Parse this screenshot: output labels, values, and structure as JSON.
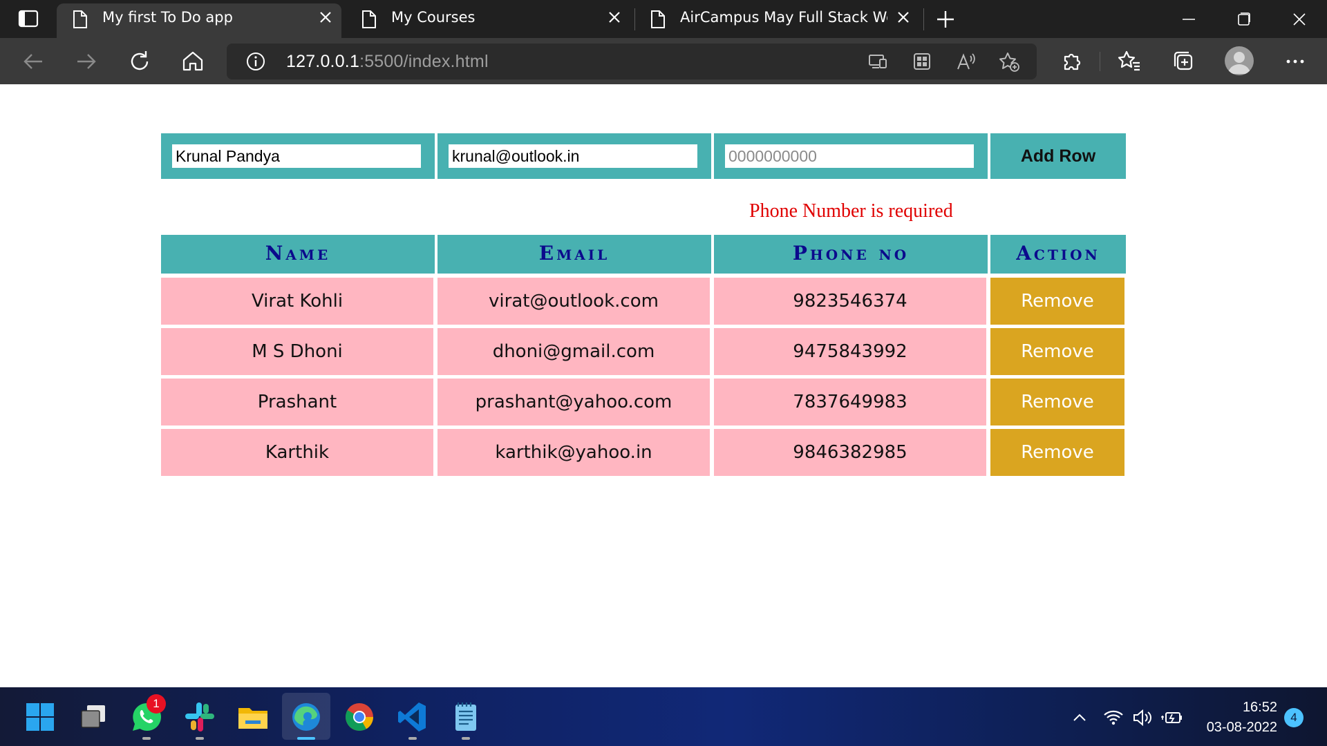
{
  "browser": {
    "tabs": [
      {
        "title": "My first To Do app",
        "active": true
      },
      {
        "title": "My Courses",
        "active": false
      },
      {
        "title": "AirCampus May Full Stack Web D",
        "active": false
      }
    ],
    "address": {
      "host": "127.0.0.1",
      "rest": ":5500/index.html"
    }
  },
  "form": {
    "name_value": "Krunal Pandya",
    "email_value": "krunal@outlook.in",
    "phone_value": "",
    "phone_placeholder": "0000000000",
    "add_label": "Add Row",
    "error": "Phone Number is required"
  },
  "table": {
    "headers": [
      "Name",
      "Email",
      "Phone no",
      "Action"
    ],
    "rows": [
      {
        "name": "Virat Kohli",
        "email": "virat@outlook.com",
        "phone": "9823546374",
        "action": "Remove"
      },
      {
        "name": "M S Dhoni",
        "email": "dhoni@gmail.com",
        "phone": "9475843992",
        "action": "Remove"
      },
      {
        "name": "Prashant",
        "email": "prashant@yahoo.com",
        "phone": "7837649983",
        "action": "Remove"
      },
      {
        "name": "Karthik",
        "email": "karthik@yahoo.in",
        "phone": "9846382985",
        "action": "Remove"
      }
    ]
  },
  "taskbar": {
    "apps": [
      "windows-start",
      "task-view",
      "whatsapp",
      "slack",
      "file-explorer",
      "edge",
      "chrome",
      "vscode",
      "notepad"
    ],
    "whatsapp_badge": "1",
    "time": "16:52",
    "date": "03-08-2022",
    "notifications": "4"
  },
  "colors": {
    "teal": "#48b1b1",
    "pink": "#ffb6c1",
    "gold": "#daa520",
    "header_text": "#0b0a8c",
    "error": "#e00000"
  }
}
